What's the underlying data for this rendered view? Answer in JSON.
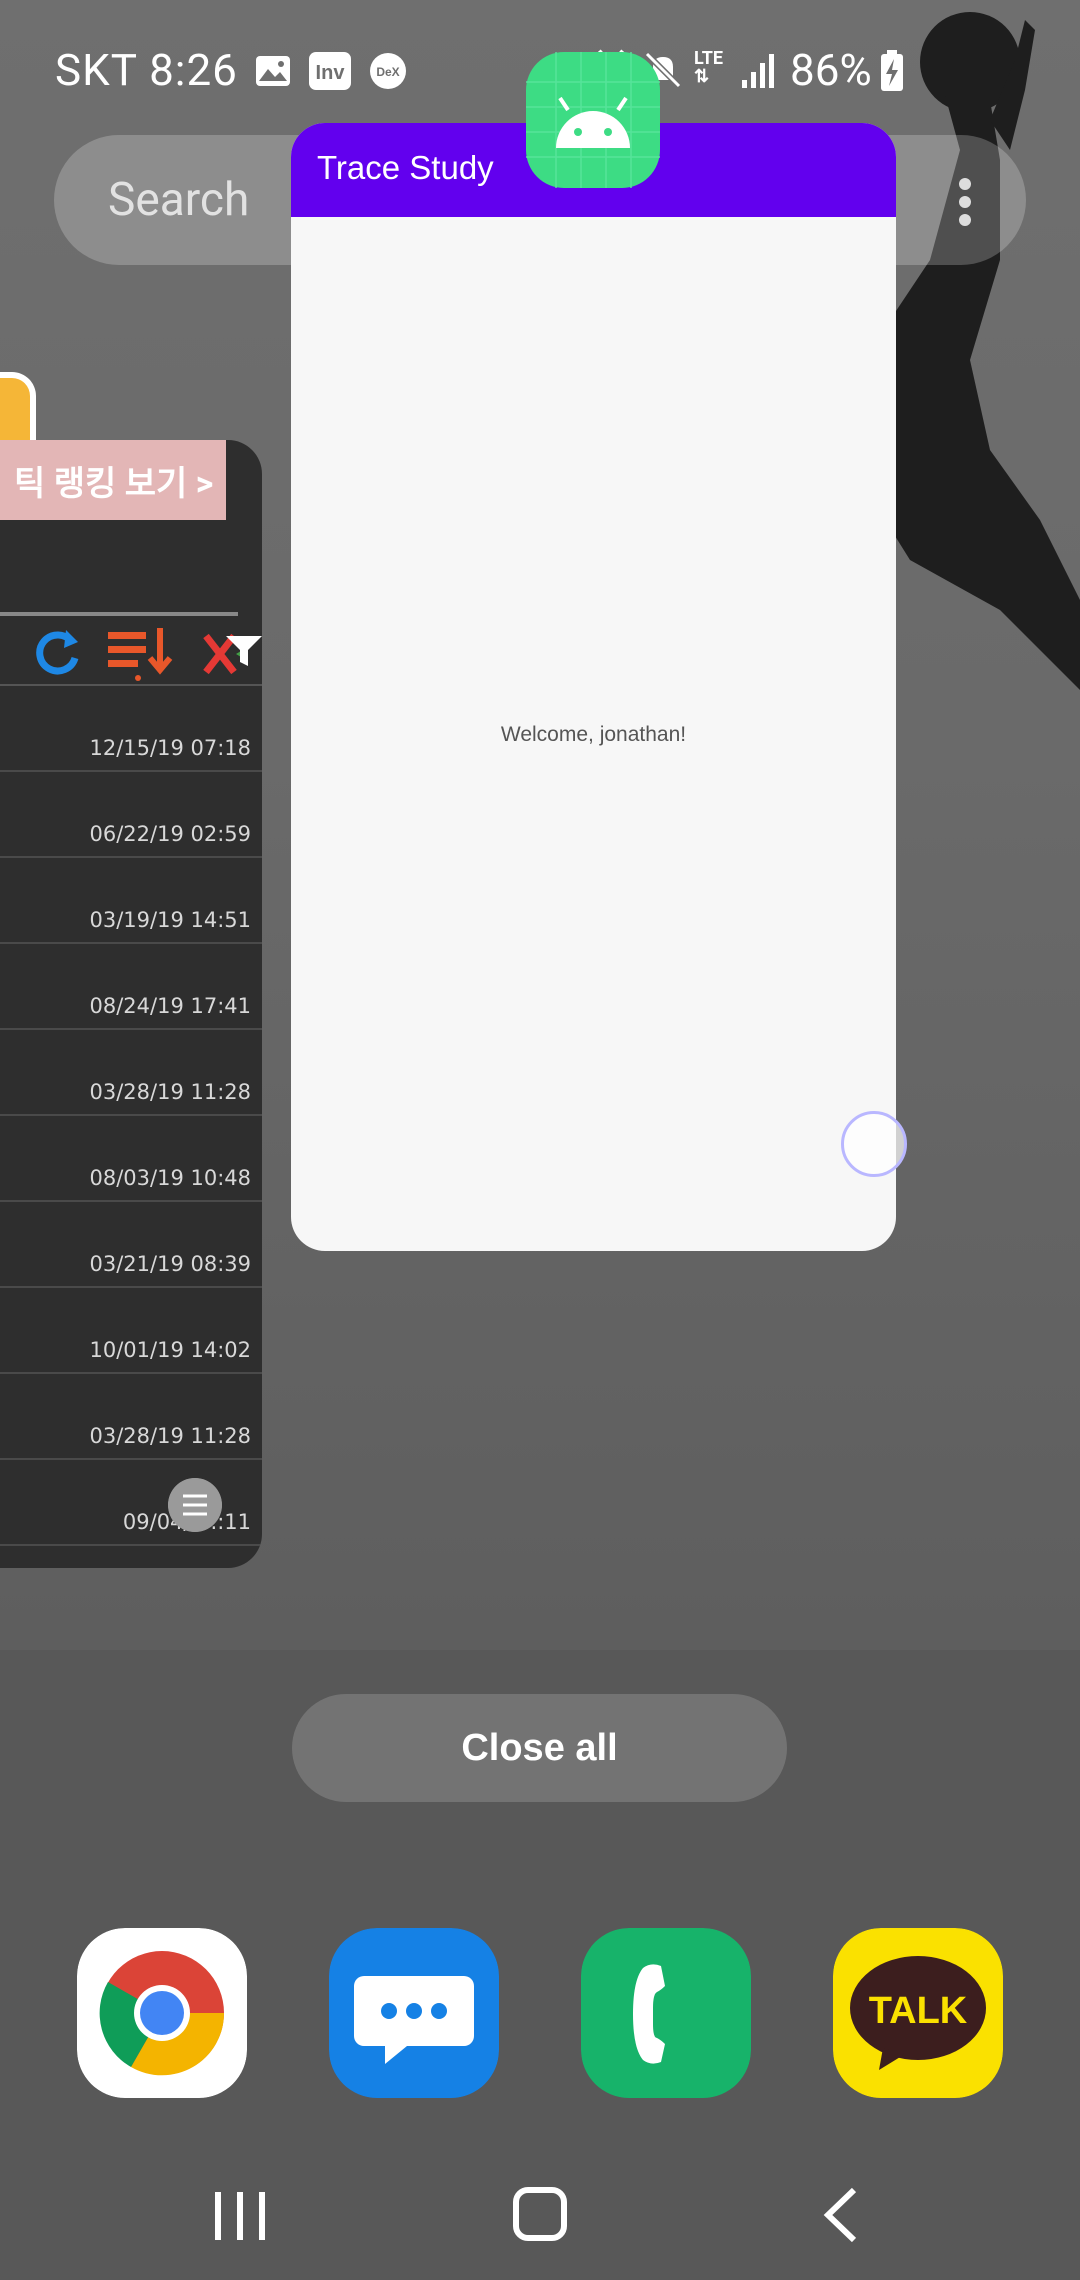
{
  "status_bar": {
    "carrier": "SKT",
    "time": "8:26",
    "battery_percent": "86%",
    "network": "LTE",
    "notification_icons": [
      "image-icon",
      "inven-icon",
      "dex-icon"
    ],
    "system_icons": [
      "alarm-icon",
      "mute-icon",
      "lte-icon",
      "signal-icon",
      "battery-charging-icon"
    ]
  },
  "search": {
    "placeholder": "Search"
  },
  "recent_apps": {
    "left_card": {
      "banner_text": "틱 랭킹 보기 >",
      "dates": [
        "12/15/19 07:18",
        "06/22/19 02:59",
        "03/19/19 14:51",
        "08/24/19 17:41",
        "03/28/19 11:28",
        "08/03/19 10:48",
        "03/21/19 08:39",
        "10/01/19 14:02",
        "03/28/19 11:28",
        "09/04/2 .:11"
      ]
    },
    "main_card": {
      "app_title": "Trace Study",
      "welcome_text": "Welcome, jonathan!",
      "app_bar_color": "#6200ee"
    }
  },
  "actions": {
    "close_all_label": "Close all"
  },
  "dock": {
    "apps": [
      "chrome-icon",
      "messages-icon",
      "phone-icon",
      "kakaotalk-icon"
    ],
    "kakao_label": "TALK"
  },
  "nav": {
    "buttons": [
      "recents-button",
      "home-button",
      "back-button"
    ]
  }
}
